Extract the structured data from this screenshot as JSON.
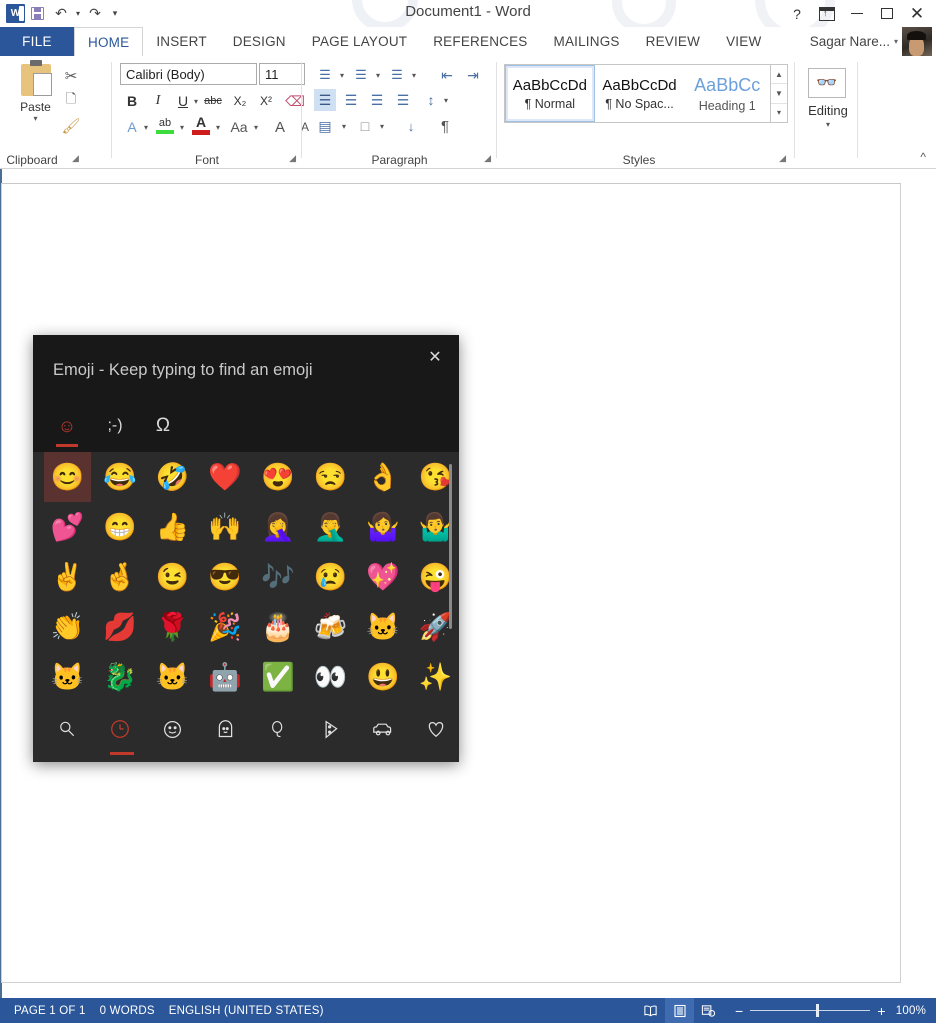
{
  "window": {
    "title": "Document1 - Word",
    "help_icon": "help-icon",
    "ribbon_display_icon": "ribbon-display-options-icon",
    "minimize_icon": "minimize-icon",
    "maximize_icon": "maximize-icon",
    "close_icon": "close-icon"
  },
  "quick_access": {
    "app_logo": "word-logo",
    "save_icon": "save-icon",
    "undo_icon": "undo-icon",
    "redo_icon": "redo-icon",
    "customize_icon": "chevron-down-icon"
  },
  "tabs": [
    {
      "label": "FILE",
      "active": false
    },
    {
      "label": "HOME",
      "active": true
    },
    {
      "label": "INSERT",
      "active": false
    },
    {
      "label": "DESIGN",
      "active": false
    },
    {
      "label": "PAGE LAYOUT",
      "active": false
    },
    {
      "label": "REFERENCES",
      "active": false
    },
    {
      "label": "MAILINGS",
      "active": false
    },
    {
      "label": "REVIEW",
      "active": false
    },
    {
      "label": "VIEW",
      "active": false
    }
  ],
  "account": {
    "name": "Sagar Nare...",
    "avatar": "user-avatar"
  },
  "ribbon": {
    "groups": [
      {
        "name": "Clipboard"
      },
      {
        "name": "Font"
      },
      {
        "name": "Paragraph"
      },
      {
        "name": "Styles"
      }
    ],
    "clipboard": {
      "paste_label": "Paste",
      "cut_icon": "scissors-icon",
      "copy_icon": "copy-icon",
      "format_painter_icon": "format-painter-icon"
    },
    "font": {
      "font_name": "Calibri (Body)",
      "font_size": "11",
      "bold": "B",
      "italic": "I",
      "underline": "U",
      "strikethrough": "abc",
      "subscript": "X₂",
      "superscript": "X²",
      "clear_formatting_icon": "clear-formatting-icon",
      "text_effects_icon": "text-effects-icon",
      "highlight_icon": "text-highlight-icon",
      "font_color_icon": "font-color-icon",
      "change_case": "Aa",
      "grow_font": "A",
      "shrink_font": "A"
    },
    "paragraph": {
      "bullets_icon": "bullets-icon",
      "numbering_icon": "numbering-icon",
      "multilevel_icon": "multilevel-list-icon",
      "decrease_indent_icon": "decrease-indent-icon",
      "increase_indent_icon": "increase-indent-icon",
      "align_left_icon": "align-left-icon",
      "align_center_icon": "align-center-icon",
      "align_right_icon": "align-right-icon",
      "justify_icon": "justify-icon",
      "line_spacing_icon": "line-spacing-icon",
      "shading_icon": "shading-icon",
      "borders_icon": "borders-icon",
      "sort_icon": "sort-icon",
      "show_marks_icon": "show-formatting-marks-icon"
    },
    "styles": {
      "items": [
        {
          "preview": "AaBbCcDd",
          "name": "¶ Normal",
          "selected": true
        },
        {
          "preview": "AaBbCcDd",
          "name": "¶ No Spac...",
          "selected": false
        },
        {
          "preview": "AaBbCc",
          "name": "Heading 1",
          "selected": false
        }
      ]
    },
    "editing": {
      "label": "Editing",
      "icon": "find-binoculars-icon"
    },
    "collapse_icon": "collapse-ribbon-icon"
  },
  "emoji_panel": {
    "title": "Emoji - Keep typing to find an emoji",
    "close_icon": "close-icon",
    "tabs": [
      {
        "glyph": "☺",
        "name": "emoji-tab-smiley",
        "active": true
      },
      {
        "glyph": ";-)",
        "name": "emoji-tab-kaomoji",
        "active": false
      },
      {
        "glyph": "Ω",
        "name": "emoji-tab-symbols",
        "active": false
      }
    ],
    "rows": [
      [
        {
          "glyph": "😊",
          "name": "smiling-face-with-smiling-eyes",
          "selected": true
        },
        {
          "glyph": "😂",
          "name": "face-with-tears-of-joy",
          "selected": false
        },
        {
          "glyph": "🤣",
          "name": "rolling-on-the-floor-laughing",
          "selected": false
        },
        {
          "glyph": "❤️",
          "name": "red-heart",
          "selected": false
        },
        {
          "glyph": "😍",
          "name": "smiling-face-with-heart-eyes",
          "selected": false
        },
        {
          "glyph": "😒",
          "name": "unamused-face",
          "selected": false
        },
        {
          "glyph": "👌",
          "name": "ok-hand",
          "selected": false
        },
        {
          "glyph": "😘",
          "name": "face-blowing-a-kiss",
          "selected": false
        }
      ],
      [
        {
          "glyph": "💕",
          "name": "two-hearts",
          "selected": false
        },
        {
          "glyph": "😁",
          "name": "beaming-face-with-smiling-eyes",
          "selected": false
        },
        {
          "glyph": "👍",
          "name": "thumbs-up",
          "selected": false
        },
        {
          "glyph": "🙌",
          "name": "raising-hands",
          "selected": false
        },
        {
          "glyph": "🤦‍♀️",
          "name": "woman-facepalming",
          "selected": false
        },
        {
          "glyph": "🤦‍♂️",
          "name": "man-facepalming",
          "selected": false
        },
        {
          "glyph": "🤷‍♀️",
          "name": "woman-shrugging",
          "selected": false
        },
        {
          "glyph": "🤷‍♂️",
          "name": "man-shrugging",
          "selected": false
        }
      ],
      [
        {
          "glyph": "✌️",
          "name": "victory-hand",
          "selected": false
        },
        {
          "glyph": "🤞",
          "name": "crossed-fingers",
          "selected": false
        },
        {
          "glyph": "😉",
          "name": "winking-face",
          "selected": false
        },
        {
          "glyph": "😎",
          "name": "smiling-face-with-sunglasses",
          "selected": false
        },
        {
          "glyph": "🎶",
          "name": "musical-notes",
          "selected": false
        },
        {
          "glyph": "😢",
          "name": "crying-face",
          "selected": false
        },
        {
          "glyph": "💖",
          "name": "sparkling-heart",
          "selected": false
        },
        {
          "glyph": "😜",
          "name": "winking-face-with-tongue",
          "selected": false
        }
      ],
      [
        {
          "glyph": "👏",
          "name": "clapping-hands",
          "selected": false
        },
        {
          "glyph": "💋",
          "name": "kiss-mark",
          "selected": false
        },
        {
          "glyph": "🌹",
          "name": "rose",
          "selected": false
        },
        {
          "glyph": "🎉",
          "name": "party-popper",
          "selected": false
        },
        {
          "glyph": "🎂",
          "name": "birthday-cake",
          "selected": false
        },
        {
          "glyph": "🍻",
          "name": "clinking-beer-mugs",
          "selected": false
        },
        {
          "glyph": "🐱",
          "name": "ninjacat",
          "selected": false
        },
        {
          "glyph": "🚀",
          "name": "ninjacat-rocket",
          "selected": false
        }
      ],
      [
        {
          "glyph": "🐱",
          "name": "ninjacat-windows",
          "selected": false
        },
        {
          "glyph": "🐉",
          "name": "ninjacat-dino",
          "selected": false
        },
        {
          "glyph": "🐱",
          "name": "ninjacat-sub",
          "selected": false
        },
        {
          "glyph": "🤖",
          "name": "ninjacat-astronaut",
          "selected": false
        },
        {
          "glyph": "✅",
          "name": "check-mark",
          "selected": false
        },
        {
          "glyph": "👀",
          "name": "eyes",
          "selected": false
        },
        {
          "glyph": "😃",
          "name": "grinning-face-with-big-eyes",
          "selected": false
        },
        {
          "glyph": "✨",
          "name": "sparkles",
          "selected": false
        }
      ]
    ],
    "nav": [
      {
        "name": "search-icon",
        "active": false
      },
      {
        "name": "recent-clock-icon",
        "active": true
      },
      {
        "name": "smiley-face-icon",
        "active": false
      },
      {
        "name": "people-icon",
        "active": false
      },
      {
        "name": "balloon-celebration-icon",
        "active": false
      },
      {
        "name": "pizza-food-icon",
        "active": false
      },
      {
        "name": "car-transport-icon",
        "active": false
      },
      {
        "name": "heart-symbols-icon",
        "active": false
      }
    ]
  },
  "status_bar": {
    "page": "PAGE 1 OF 1",
    "words": "0 WORDS",
    "language": "ENGLISH (UNITED STATES)",
    "views": [
      {
        "name": "read-mode-icon",
        "active": false
      },
      {
        "name": "print-layout-icon",
        "active": true
      },
      {
        "name": "web-layout-icon",
        "active": false
      }
    ],
    "zoom_out_icon": "zoom-out-icon",
    "zoom_in_icon": "zoom-in-icon",
    "zoom_level": "100%"
  },
  "colors": {
    "word_blue": "#2b579a",
    "panel_bg": "#2b2b2b",
    "panel_header": "#181818",
    "accent_red": "#c0392b",
    "selected_cell": "#5a3330"
  }
}
